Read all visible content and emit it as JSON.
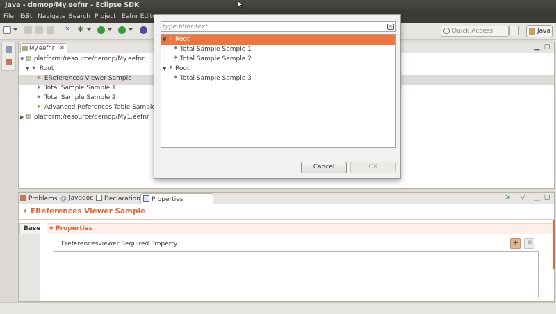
{
  "window": {
    "title": "Java - demop/My.eefnr - Eclipse SDK"
  },
  "menu": [
    "File",
    "Edit",
    "Navigate",
    "Search",
    "Project",
    "Eefnr Edito"
  ],
  "toolbar": {
    "quick_access_placeholder": "Quick Access",
    "perspective_label": "Java"
  },
  "editor": {
    "tab_label": "My.eefnr",
    "tab_close": "⊠",
    "tree": [
      {
        "label": "platform:/resource/demop/My.eefnr",
        "expanded": true,
        "icon": "file-icon"
      },
      {
        "label": "Root",
        "expanded": true,
        "icon": "root-icon"
      },
      {
        "label": "EReferences Viewer Sample",
        "selected": true,
        "icon": "sample-icon"
      },
      {
        "label": "Total Sample Sample 1",
        "icon": "sample-icon"
      },
      {
        "label": "Total Sample Sample 2",
        "icon": "sample-icon"
      },
      {
        "label": "Advanced References Table Sample",
        "icon": "sample-icon"
      },
      {
        "label": "platform:/resource/demop/My1.eefnr",
        "expanded": false,
        "icon": "file-icon"
      }
    ]
  },
  "bottom": {
    "tabs": [
      "Problems",
      "Javadoc",
      "Declaration",
      "Properties"
    ],
    "active_tab": "Properties",
    "header_title": "EReferences Viewer Sample",
    "base_tab": "Base",
    "section_label": "Properties",
    "required_property_label": "Ereferencesviewer Required Property"
  },
  "dialog": {
    "filter_placeholder": "type filter text",
    "tree": [
      {
        "label": "Root",
        "level": 0,
        "expanded": true,
        "selected": true
      },
      {
        "label": "Total Sample Sample 1",
        "level": 1
      },
      {
        "label": "Total Sample Sample 2",
        "level": 1
      },
      {
        "label": "Root",
        "level": 0,
        "expanded": true
      },
      {
        "label": "Total Sample Sample 3",
        "level": 1
      }
    ],
    "cancel_label": "Cancel",
    "ok_label": "OK"
  },
  "colors": {
    "accent": "#e0663b",
    "selection": "#ef7540",
    "title_bar": "#3c3b37"
  }
}
